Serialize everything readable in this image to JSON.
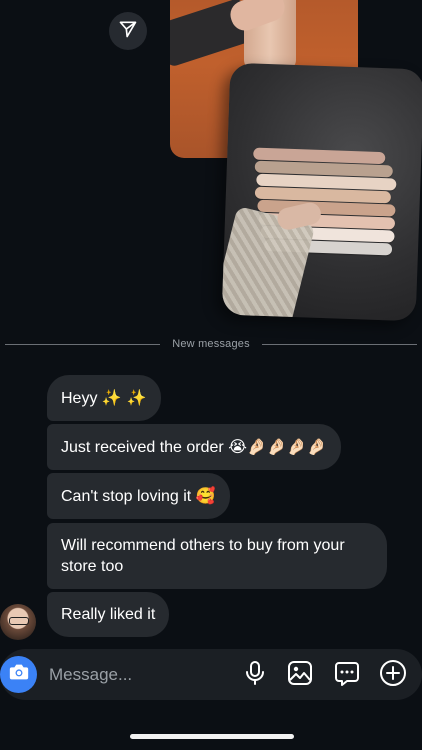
{
  "divider": {
    "label": "New messages"
  },
  "messages": [
    {
      "text": "Heyy",
      "emoji": "✨ ✨"
    },
    {
      "text": "Just received the order",
      "emoji": "😭🤌🏻🤌🏻🤌🏻🤌🏻"
    },
    {
      "text": "Can't stop loving it",
      "emoji": "🥰"
    },
    {
      "text": "Will recommend others to buy from your store too",
      "emoji": ""
    },
    {
      "text": "Really liked it",
      "emoji": ""
    }
  ],
  "composer": {
    "placeholder": "Message...",
    "icons": [
      "camera-icon",
      "microphone-icon",
      "gallery-icon",
      "sticker-icon",
      "plus-icon"
    ]
  },
  "media": {
    "icons": [
      "send-icon"
    ],
    "stack_colors": [
      "#c9a596",
      "#b9a18f",
      "#e7d3c4",
      "#d9b8a0",
      "#caa38c",
      "#e3c1b0",
      "#f0e4dc",
      "#d7d3cf"
    ]
  },
  "colors": {
    "bubble": "#262a2f",
    "background": "#0b0f14",
    "accent": "#3b82f6"
  }
}
